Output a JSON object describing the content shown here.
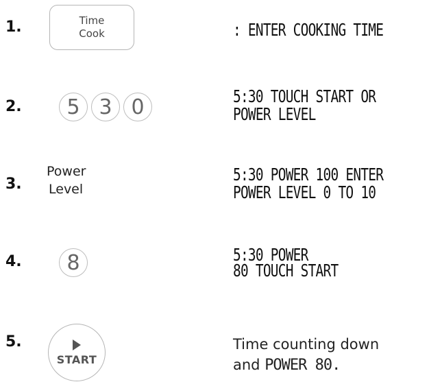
{
  "steps": [
    {
      "number": "1.",
      "button_line1": "Time",
      "button_line2": "Cook",
      "display_line1": ": ENTER COOKING TIME"
    },
    {
      "number": "2.",
      "keys": [
        "5",
        "3",
        "0"
      ],
      "display_line1": "5:30 TOUCH START OR",
      "display_line2": "POWER LEVEL"
    },
    {
      "number": "3.",
      "label_line1": "Power",
      "label_line2": "Level",
      "display_line1": "5:30 POWER 100 ENTER",
      "display_line2": "POWER LEVEL 0 TO 10"
    },
    {
      "number": "4.",
      "keys": [
        "8"
      ],
      "display_line1": "5:30 POWER",
      "display_line2": "80 TOUCH START"
    },
    {
      "number": "5.",
      "button_label": "START",
      "note_line1": "Time counting down",
      "note_prefix": "and ",
      "note_segment": "POWER 80."
    }
  ]
}
